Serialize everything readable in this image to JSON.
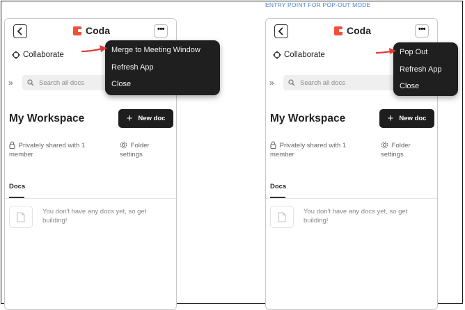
{
  "caption": "ENTRY POINT FOR POP-OUT MODE",
  "app": {
    "name": "Coda",
    "collaborate_label": "Collaborate",
    "search_placeholder": "Search all docs",
    "workspace_title": "My Workspace",
    "new_doc_label": "New doc",
    "shared_text": "Privately shared with 1 member",
    "folder_settings_label": "Folder settings",
    "docs_tab": "Docs",
    "empty_message": "You don't have any docs yet, so get building!"
  },
  "menus": {
    "left": [
      "Merge to Meeting Window",
      "Refresh App",
      "Close"
    ],
    "right": [
      "Pop Out",
      "Refresh App",
      "Close"
    ]
  },
  "colors": {
    "brand": "#f2503a",
    "menu_bg": "#1f1f1f",
    "arrow": "#e03a3a",
    "caption": "#4a7fd6"
  }
}
